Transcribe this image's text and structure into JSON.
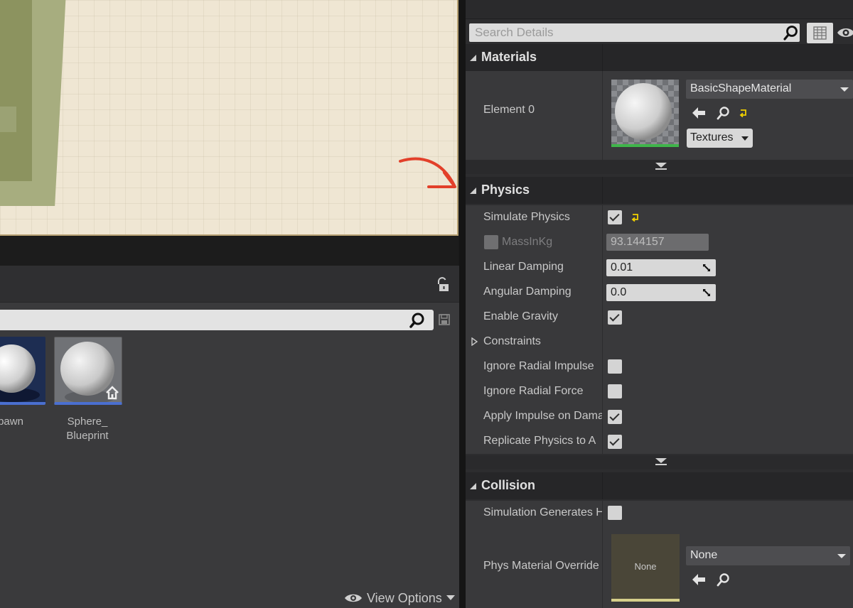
{
  "content_browser": {
    "assets": [
      {
        "label": "Pawn",
        "label_display": "pawn"
      },
      {
        "label": "Sphere_\nBlueprint",
        "label_line1": "Sphere_",
        "label_line2": "Blueprint"
      }
    ],
    "view_options_label": "View Options"
  },
  "details": {
    "search_placeholder": "Search Details",
    "categories": {
      "materials": "Materials",
      "physics": "Physics",
      "collision": "Collision"
    },
    "materials": {
      "element_label": "Element 0",
      "material_value": "BasicShapeMaterial",
      "textures_button": "Textures"
    },
    "physics": {
      "simulate_physics": {
        "label": "Simulate Physics",
        "checked": true
      },
      "mass_in_kg": {
        "label": "MassInKg",
        "value": "93.144157",
        "enabled": false
      },
      "linear_damping": {
        "label": "Linear Damping",
        "value": "0.01"
      },
      "angular_damping": {
        "label": "Angular Damping",
        "value": "0.0"
      },
      "enable_gravity": {
        "label": "Enable Gravity",
        "checked": true
      },
      "constraints": {
        "label": "Constraints"
      },
      "ignore_radial_impulse": {
        "label": "Ignore Radial Impulse",
        "checked": false
      },
      "ignore_radial_force": {
        "label": "Ignore Radial Force",
        "checked": false
      },
      "apply_impulse": {
        "label": "Apply Impulse on Dama",
        "checked": true
      },
      "replicate_physics": {
        "label": "Replicate Physics to A",
        "checked": true
      }
    },
    "collision": {
      "simulation_generates": {
        "label": "Simulation Generates H",
        "checked": false
      },
      "phys_material_override": {
        "label": "Phys Material Override",
        "value": "None",
        "thumb_text": "None"
      }
    }
  },
  "colors": {
    "annotation_arrow": "#e2402a",
    "asset_underline": "#4a6fd0",
    "material_underline": "#3fb54a",
    "reset_arrow": "#f0d000"
  }
}
